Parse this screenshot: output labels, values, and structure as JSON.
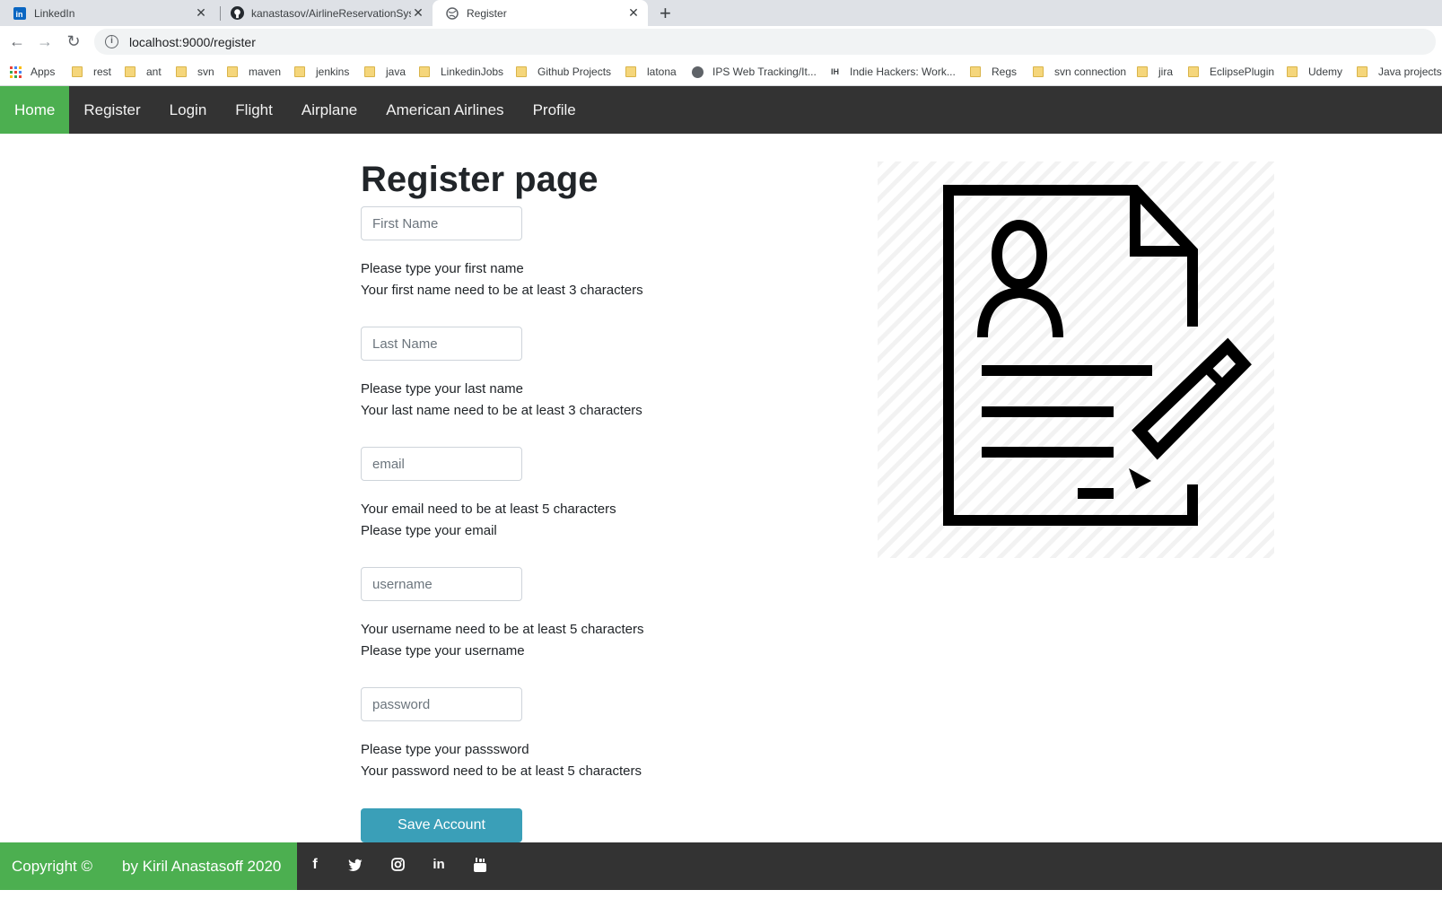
{
  "browser": {
    "tabs": [
      {
        "title": "LinkedIn",
        "icon": "linkedin-icon"
      },
      {
        "title": "kanastasov/AirlineReservationSys",
        "icon": "github-icon"
      },
      {
        "title": "Register",
        "icon": "globe-icon"
      }
    ],
    "close_glyph": "✕",
    "new_tab_glyph": "+",
    "url": "localhost:9000/register",
    "bookmarks": [
      "Apps",
      "rest",
      "ant",
      "svn",
      "maven",
      "jenkins",
      "java",
      "LinkedinJobs",
      "Github Projects",
      "latona",
      "IPS Web Tracking/It...",
      "Indie Hackers: Work...",
      "Regs",
      "svn connection",
      "jira",
      "EclipsePlugin",
      "Udemy",
      "Java projects"
    ]
  },
  "nav": {
    "items": [
      "Home",
      "Register",
      "Login",
      "Flight",
      "Airplane",
      "American Airlines",
      "Profile"
    ],
    "active_color": "#4caf50",
    "bg_color": "#333333"
  },
  "form": {
    "title": "Register page",
    "fields": [
      {
        "placeholder": "First Name",
        "hint1": "Please type your first name",
        "hint2": "Your first name need to be at least 3 characters"
      },
      {
        "placeholder": "Last Name",
        "hint1": "Please type your last name",
        "hint2": "Your last name need to be at least 3 characters"
      },
      {
        "placeholder": "email",
        "hint1": "Your email need to be at least 5 characters",
        "hint2": "Please type your email"
      },
      {
        "placeholder": "username",
        "hint1": "Your username need to be at least 5 characters",
        "hint2": "Please type your username"
      },
      {
        "placeholder": "password",
        "hint1": "Please type your passsword",
        "hint2": "Your password need to be at least 5 characters"
      }
    ],
    "submit_label": "Save Account",
    "submit_color": "#3a9fb8"
  },
  "footer": {
    "copyright": "Copyright ©",
    "author": "by Kiril Anastasoff 2020",
    "social": [
      "facebook-icon",
      "twitter-icon",
      "instagram-icon",
      "linkedin-icon",
      "youtube-icon"
    ]
  }
}
